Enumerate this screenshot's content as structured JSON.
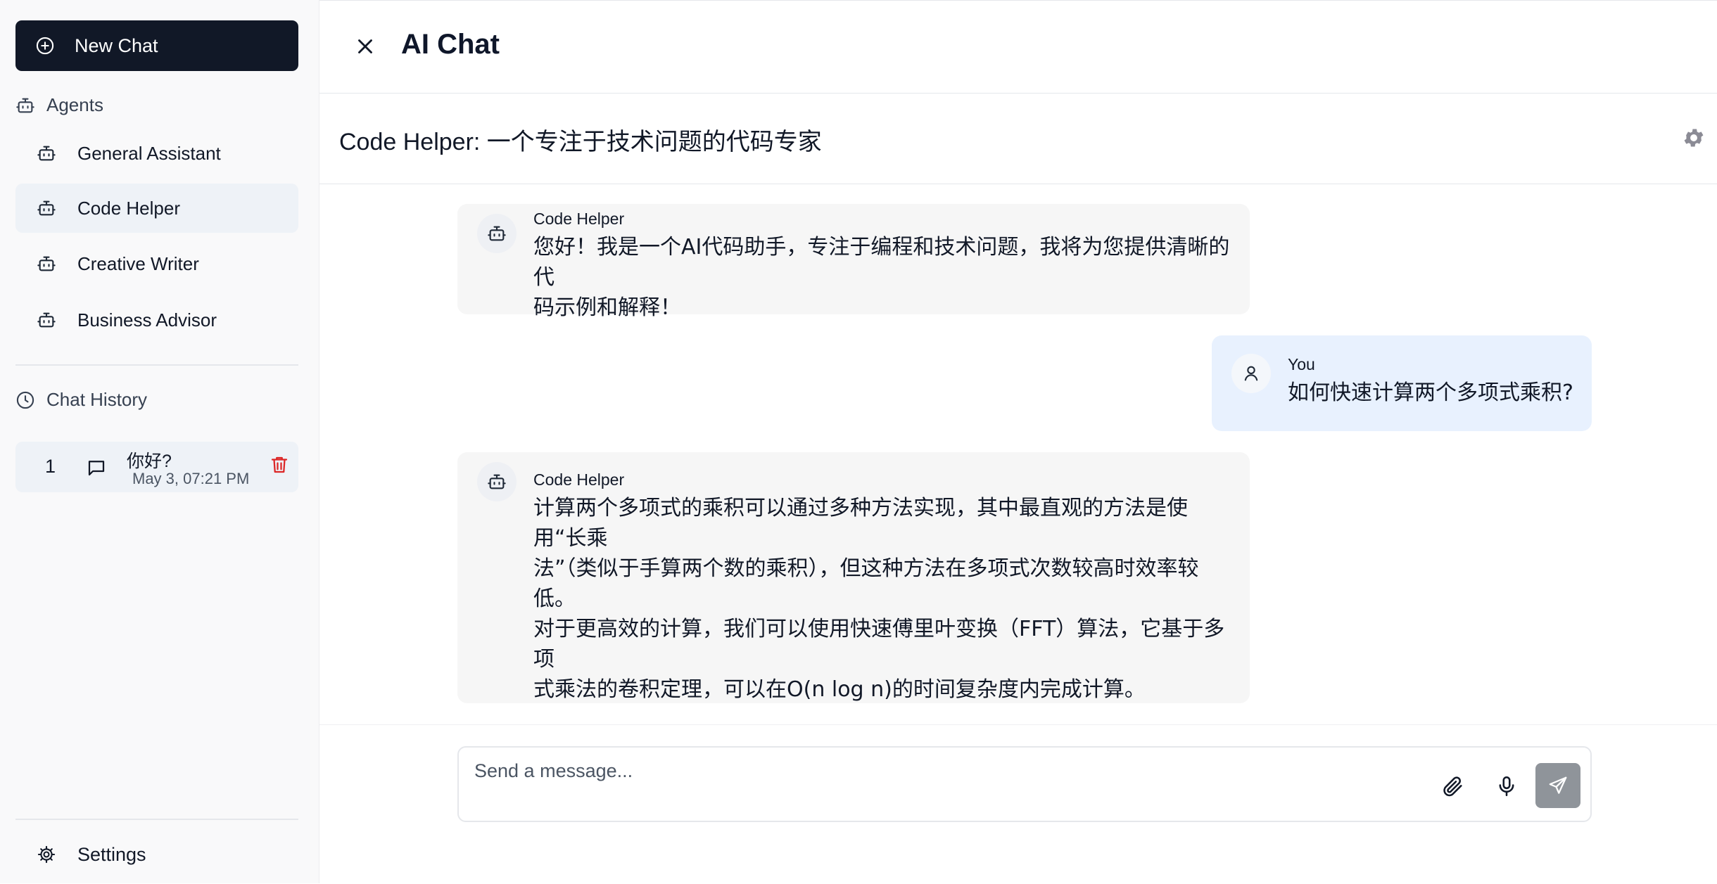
{
  "sidebar": {
    "new_chat_label": "New Chat",
    "agents_heading": "Agents",
    "agents": [
      {
        "label": "General Assistant",
        "active": false
      },
      {
        "label": "Code Helper",
        "active": true
      },
      {
        "label": "Creative Writer",
        "active": false
      },
      {
        "label": "Business Advisor",
        "active": false
      }
    ],
    "history_heading": "Chat History",
    "history": [
      {
        "number": "1",
        "title": "你好?",
        "date": "May 3, 07:21 PM"
      }
    ],
    "settings_label": "Settings"
  },
  "header": {
    "title": "AI Chat"
  },
  "agent_bar": {
    "title": "Code Helper: 一个专注于技术问题的代码专家"
  },
  "messages": [
    {
      "sender": "Code Helper",
      "role": "bot",
      "text": "您好！我是一个AI代码助手，专注于编程和技术问题，我将为您提供清晰的代\n码示例和解释！"
    },
    {
      "sender": "You",
      "role": "user",
      "text": "如何快速计算两个多项式乘积?"
    },
    {
      "sender": "Code Helper",
      "role": "bot",
      "text": "计算两个多项式的乘积可以通过多种方法实现，其中最直观的方法是使用“长乘\n法”（类似于手算两个数的乘积），但这种方法在多项式次数较高时效率较低。\n对于更高效的计算，我们可以使用快速傅里叶变换（FFT）算法，它基于多项\n式乘法的卷积定理，可以在O(n log n)的时间复杂度内完成计算。\n\n下面是一个使用Python中的NumPy库和FFT算法来计算两个多项式乘积的示\n例："
    }
  ],
  "composer": {
    "placeholder": "Send a message..."
  },
  "colors": {
    "primary_button": "#111827",
    "active_item": "#eef2f7",
    "user_bubble": "#e8f1fe",
    "bot_bubble": "#f6f6f6",
    "delete_icon": "#dc2626",
    "send_button": "#8f949a"
  },
  "icons": [
    "plus-circle-icon",
    "robot-icon",
    "clock-icon",
    "message-icon",
    "trash-icon",
    "gear-icon",
    "close-icon",
    "user-icon",
    "paperclip-icon",
    "mic-icon",
    "send-icon"
  ]
}
